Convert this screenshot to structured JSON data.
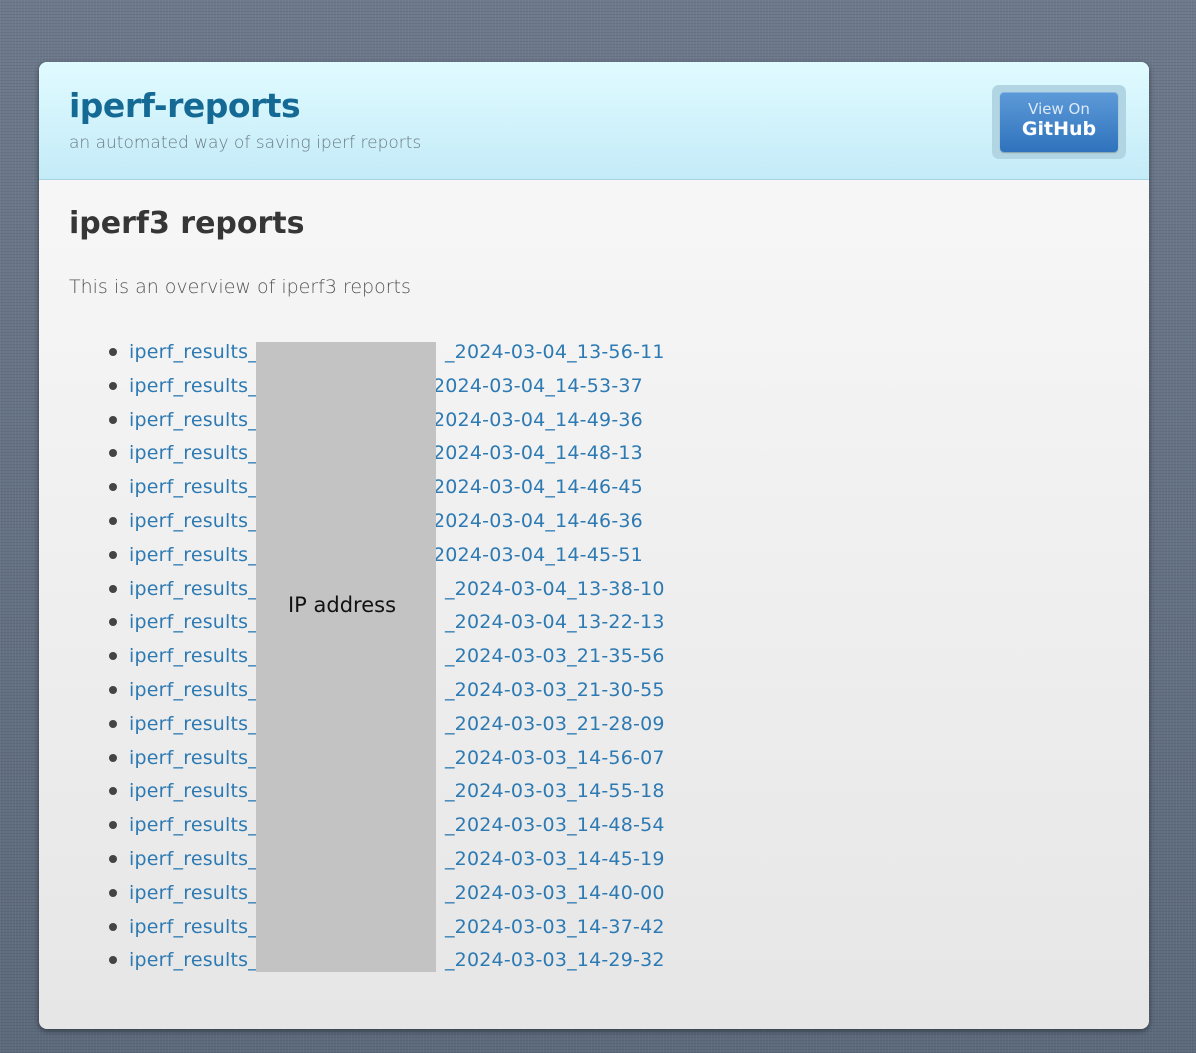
{
  "header": {
    "site_title": "iperf-reports",
    "tagline": "an automated way of saving iperf reports",
    "github_button": {
      "small_label": "View On",
      "big_label": "GitHub"
    }
  },
  "main": {
    "heading": "iperf3 reports",
    "intro": "This is an overview of iperf3 reports",
    "reports": [
      {
        "prefix": "iperf_results_",
        "suffix": "_2024-03-04_13-56-11"
      },
      {
        "prefix": "iperf_results_",
        "suffix": "2024-03-04_14-53-37"
      },
      {
        "prefix": "iperf_results_",
        "suffix": "2024-03-04_14-49-36"
      },
      {
        "prefix": "iperf_results_",
        "suffix": "2024-03-04_14-48-13"
      },
      {
        "prefix": "iperf_results_",
        "suffix": "2024-03-04_14-46-45"
      },
      {
        "prefix": "iperf_results_",
        "suffix": "2024-03-04_14-46-36"
      },
      {
        "prefix": "iperf_results_",
        "suffix": "2024-03-04_14-45-51"
      },
      {
        "prefix": "iperf_results_",
        "suffix": "_2024-03-04_13-38-10"
      },
      {
        "prefix": "iperf_results_",
        "suffix": "_2024-03-04_13-22-13"
      },
      {
        "prefix": "iperf_results_",
        "suffix": "_2024-03-03_21-35-56"
      },
      {
        "prefix": "iperf_results_",
        "suffix": "_2024-03-03_21-30-55"
      },
      {
        "prefix": "iperf_results_",
        "suffix": "_2024-03-03_21-28-09"
      },
      {
        "prefix": "iperf_results_",
        "suffix": "_2024-03-03_14-56-07"
      },
      {
        "prefix": "iperf_results_",
        "suffix": "_2024-03-03_14-55-18"
      },
      {
        "prefix": "iperf_results_",
        "suffix": "_2024-03-03_14-48-54"
      },
      {
        "prefix": "iperf_results_",
        "suffix": "_2024-03-03_14-45-19"
      },
      {
        "prefix": "iperf_results_",
        "suffix": "_2024-03-03_14-40-00"
      },
      {
        "prefix": "iperf_results_",
        "suffix": "_2024-03-03_14-37-42"
      },
      {
        "prefix": "iperf_results_",
        "suffix": "_2024-03-03_14-29-32"
      }
    ],
    "redaction_label": "IP address"
  }
}
